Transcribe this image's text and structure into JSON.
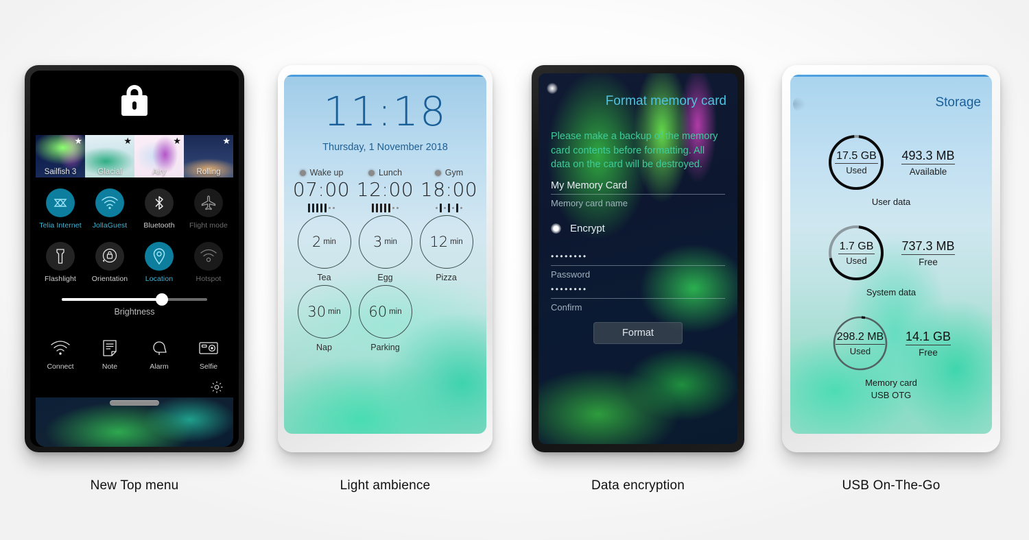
{
  "panels": [
    {
      "caption": "New Top menu"
    },
    {
      "caption": "Light ambience"
    },
    {
      "caption": "Data encryption"
    },
    {
      "caption": "USB On-The-Go"
    }
  ],
  "top_menu": {
    "lock_icon": "lock-icon",
    "ambiences": [
      {
        "name": "Sailfish 3",
        "star": "★",
        "favorite": true
      },
      {
        "name": "Glacial",
        "star": "★",
        "favorite": true
      },
      {
        "name": "Airy",
        "star": "★",
        "favorite": true
      },
      {
        "name": "Rolling",
        "star": "★",
        "favorite": true
      }
    ],
    "toggles": [
      {
        "label": "Telia Internet",
        "icon": "mobile-data-icon",
        "state": "on"
      },
      {
        "label": "JollaGuest",
        "icon": "wifi-icon",
        "state": "on"
      },
      {
        "label": "Bluetooth",
        "icon": "bluetooth-icon",
        "state": "off"
      },
      {
        "label": "Flight mode",
        "icon": "airplane-icon",
        "state": "dim"
      },
      {
        "label": "Flashlight",
        "icon": "flashlight-icon",
        "state": "off"
      },
      {
        "label": "Orientation",
        "icon": "rotation-lock-icon",
        "state": "off"
      },
      {
        "label": "Location",
        "icon": "location-pin-icon",
        "state": "on"
      },
      {
        "label": "Hotspot",
        "icon": "hotspot-icon",
        "state": "dim"
      }
    ],
    "brightness": {
      "label": "Brightness",
      "value": 69
    },
    "shortcuts": [
      {
        "label": "Connect",
        "icon": "wifi-icon"
      },
      {
        "label": "Note",
        "icon": "note-icon"
      },
      {
        "label": "Alarm",
        "icon": "alarm-bell-icon"
      },
      {
        "label": "Selfie",
        "icon": "camera-icon"
      }
    ],
    "settings_icon": "gear-icon"
  },
  "lock_screen": {
    "time": "11:18",
    "date": "Thursday, 1 November 2018",
    "alarms": [
      {
        "name": "Wake up",
        "time": "07:00",
        "days": [
          1,
          1,
          1,
          1,
          1,
          0,
          0
        ]
      },
      {
        "name": "Lunch",
        "time": "12:00",
        "days": [
          1,
          1,
          1,
          1,
          1,
          0,
          0
        ]
      },
      {
        "name": "Gym",
        "time": "18:00",
        "days": [
          0,
          1,
          0,
          1,
          0,
          1,
          0
        ]
      }
    ],
    "timers": [
      {
        "value": "2",
        "unit": "min",
        "name": "Tea"
      },
      {
        "value": "3",
        "unit": "min",
        "name": "Egg"
      },
      {
        "value": "12",
        "unit": "min",
        "name": "Pizza"
      },
      {
        "value": "30",
        "unit": "min",
        "name": "Nap"
      },
      {
        "value": "60",
        "unit": "min",
        "name": "Parking"
      }
    ]
  },
  "encryption": {
    "title": "Format memory card",
    "body": "Please make a backup of the memory card contents before formatting. All data on the card will be destroyed.",
    "name_field": {
      "value": "My Memory Card",
      "label": "Memory card name"
    },
    "encrypt": {
      "label": "Encrypt",
      "checked": true
    },
    "password_field": {
      "value": "••••••••",
      "label": "Password"
    },
    "confirm_field": {
      "value": "••••••••",
      "label": "Confirm"
    },
    "format_button": "Format"
  },
  "storage": {
    "title": "Storage",
    "items": [
      {
        "used": "17.5 GB",
        "used_label": "Used",
        "free": "493.3 MB",
        "free_label": "Available",
        "name": "User data",
        "pct": 97,
        "style": "dark"
      },
      {
        "used": "1.7 GB",
        "used_label": "Used",
        "free": "737.3 MB",
        "free_label": "Free",
        "name": "System data",
        "pct": 70,
        "style": "dark"
      },
      {
        "used": "298.2 MB",
        "used_label": "Used",
        "free": "14.1 GB",
        "free_label": "Free",
        "name": "Memory card\nUSB OTG",
        "pct": 2,
        "style": "light"
      }
    ]
  },
  "colors": {
    "accent_blue": "#0d7e9e",
    "accent_cyan": "#3fb6d8",
    "title_blue": "#1a5f98",
    "dialog_title": "#4fc2e0",
    "dialog_body": "#3ecb9b"
  }
}
